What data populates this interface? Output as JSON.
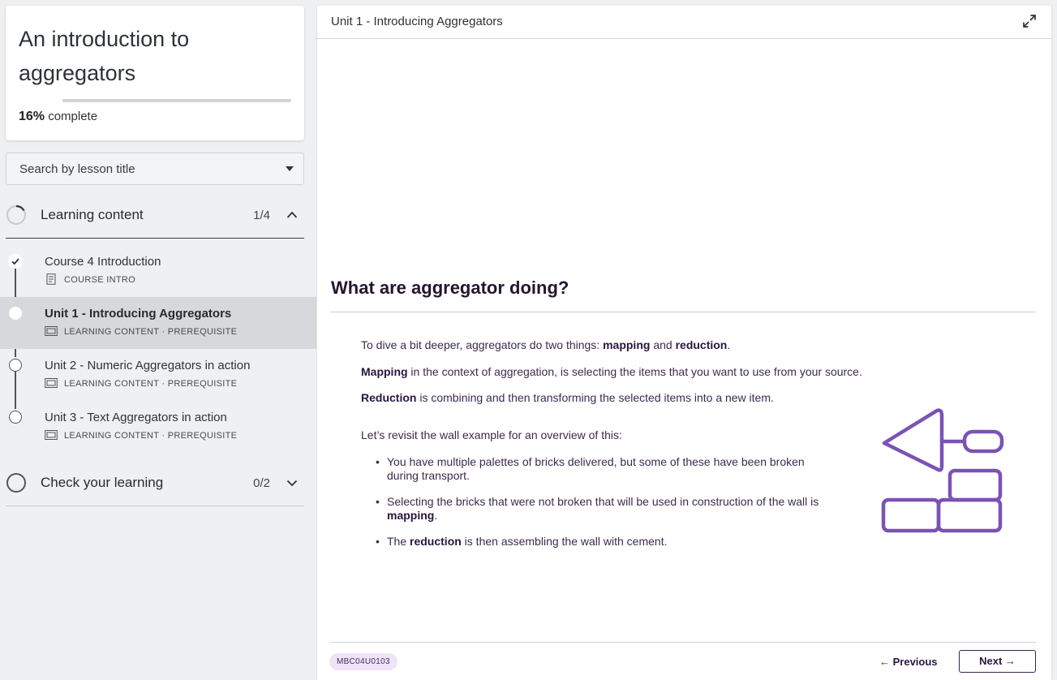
{
  "course": {
    "title": "An introduction to aggregators",
    "progress_percent": 16,
    "progress_pct_label": "16%",
    "progress_suffix": "complete"
  },
  "search": {
    "placeholder": "Search by lesson title"
  },
  "sections": [
    {
      "title": "Learning content",
      "count": "1/4",
      "expanded": true,
      "lessons": [
        {
          "name": "Course 4 Introduction",
          "meta": "COURSE INTRO",
          "completed": true,
          "active": false
        },
        {
          "name": "Unit 1 - Introducing Aggregators",
          "meta": "LEARNING CONTENT · PREREQUISITE",
          "completed": false,
          "active": true
        },
        {
          "name": "Unit 2 - Numeric Aggregators in action",
          "meta": "LEARNING CONTENT · PREREQUISITE",
          "completed": false,
          "active": false
        },
        {
          "name": "Unit 3 - Text Aggregators in action",
          "meta": "LEARNING CONTENT · PREREQUISITE",
          "completed": false,
          "active": false
        }
      ]
    },
    {
      "title": "Check your learning",
      "count": "0/2",
      "expanded": false
    }
  ],
  "main": {
    "breadcrumb": "Unit 1 - Introducing Aggregators",
    "heading": "What are aggregator doing?",
    "p1": {
      "pre": "To dive a bit deeper, aggregators do two things: ",
      "b1": "mapping",
      "mid": " and ",
      "b2": "reduction",
      "post": "."
    },
    "p2": {
      "b": "Mapping",
      "rest": " in the context of aggregation, is selecting the items that you want to use from your source."
    },
    "p3": {
      "b": "Reduction",
      "rest": " is combining and then transforming the selected items into a new item."
    },
    "p4": "Let’s revisit the wall example for an overview of this:",
    "bullets": [
      {
        "pre": "You have multiple palettes of bricks delivered, but some of these have been broken during transport.",
        "b": "",
        "post": ""
      },
      {
        "pre": "Selecting the bricks that were not broken that will be used in construction of the wall is ",
        "b": "mapping",
        "post": "."
      },
      {
        "pre": "The ",
        "b": "reduction",
        "post": " is then assembling the wall with cement."
      }
    ],
    "illustration_icon": "trowel-and-bricks-icon",
    "code_badge": "MBC04U0103",
    "prev_label": "← Previous",
    "next_label": "Next →"
  },
  "colors": {
    "accent_purple": "#7b52b5",
    "heading_purple": "#241530",
    "active_row": "#d6d8db",
    "badge_bg": "#efe3f7"
  }
}
